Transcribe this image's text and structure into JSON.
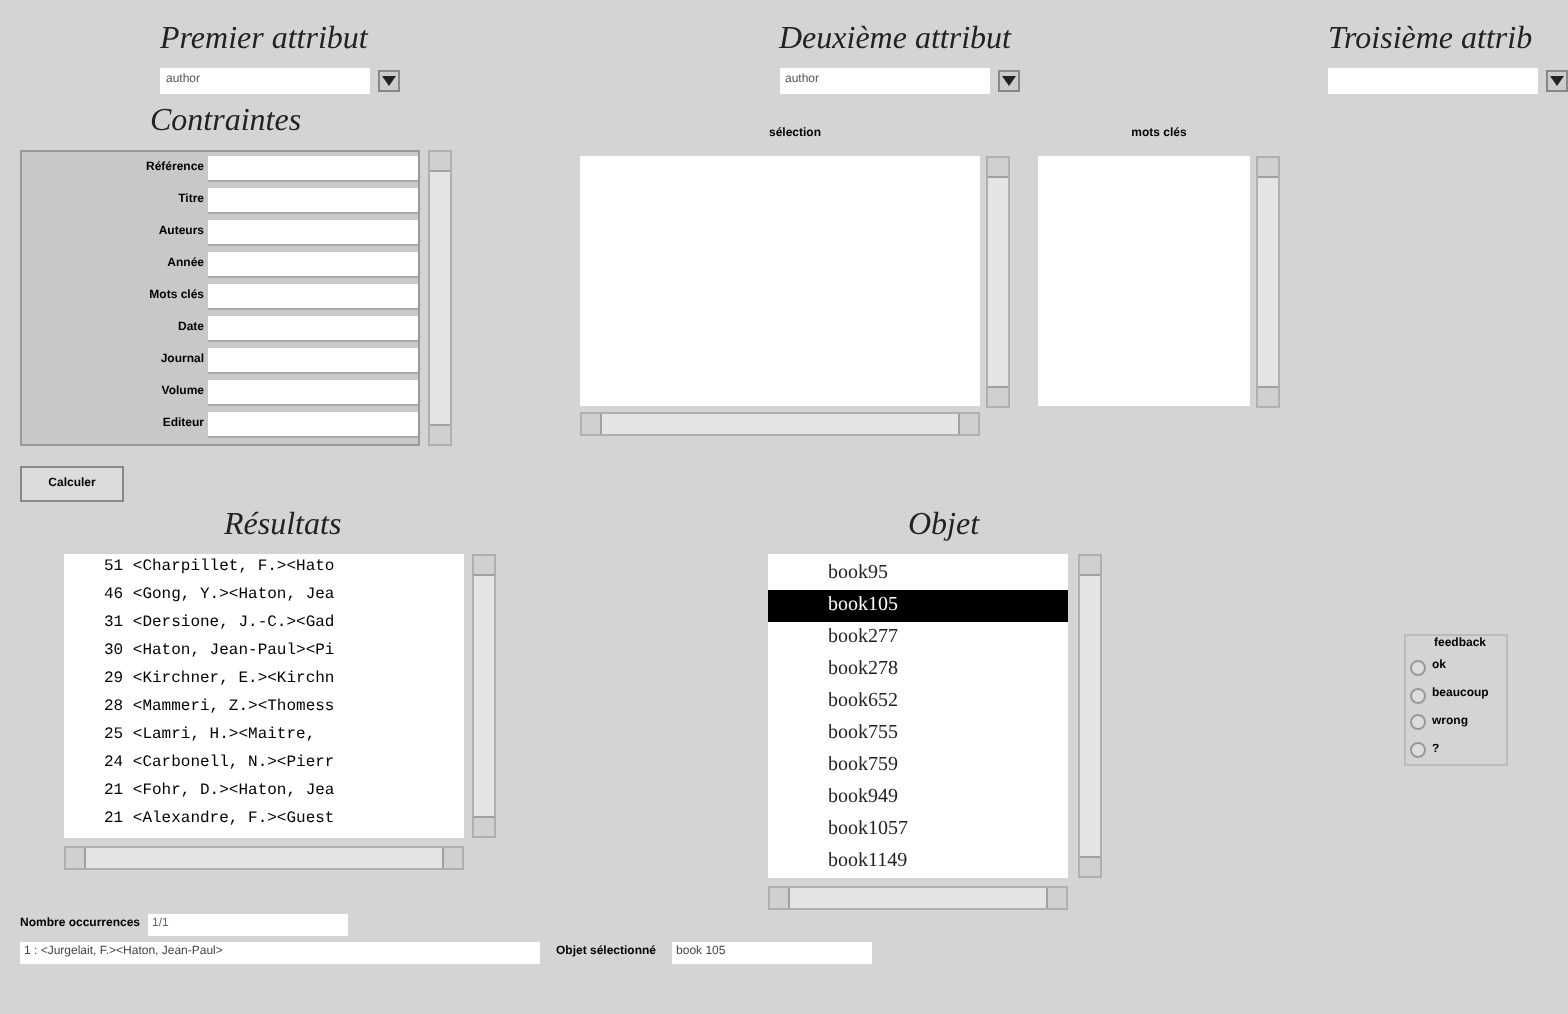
{
  "attributes": [
    {
      "title": "Premier attribut",
      "value": "author"
    },
    {
      "title": "Deuxième attribut",
      "value": "author"
    },
    {
      "title": "Troisième attrib"
    }
  ],
  "constraints": {
    "title": "Contraintes",
    "fields": [
      "Référence",
      "Titre",
      "Auteurs",
      "Année",
      "Mots clés",
      "Date",
      "Journal",
      "Volume",
      "Editeur"
    ]
  },
  "lists": [
    {
      "header": "sélection"
    },
    {
      "header": "mots clés"
    }
  ],
  "calculate_button": "Calculer",
  "results": {
    "title": "Résultats",
    "rows": [
      "51 <Charpillet, F.><Hato",
      "46 <Gong, Y.><Haton, Jea",
      "31 <Dersione, J.-C.><Gad",
      "30 <Haton, Jean-Paul><Pi",
      "29 <Kirchner, E.><Kirchn",
      "28 <Mammeri, Z.><Thomess",
      "25 <Lamri, H.><Maitre,",
      "24 <Carbonell, N.><Pierr",
      "21 <Fohr, D.><Haton, Jea",
      "21 <Alexandre, F.><Guest"
    ]
  },
  "object": {
    "title": "Objet",
    "items": [
      {
        "label": "book95",
        "selected": false
      },
      {
        "label": "book105",
        "selected": true
      },
      {
        "label": "book277",
        "selected": false
      },
      {
        "label": "book278",
        "selected": false
      },
      {
        "label": "book652",
        "selected": false
      },
      {
        "label": "book755",
        "selected": false
      },
      {
        "label": "book759",
        "selected": false
      },
      {
        "label": "book949",
        "selected": false
      },
      {
        "label": "book1057",
        "selected": false
      },
      {
        "label": "book1149",
        "selected": false
      }
    ]
  },
  "feedback": {
    "title": "feedback",
    "options": [
      {
        "label": "ok",
        "selected": false
      },
      {
        "label": "beaucoup",
        "selected": false
      },
      {
        "label": "wrong",
        "selected": false
      },
      {
        "label": "?",
        "selected": false
      }
    ]
  },
  "occurrences": {
    "label": "Nombre occurrences",
    "value": "1/1"
  },
  "status": {
    "text": "1 : <Jurgelait, F.><Haton, Jean-Paul>",
    "object_label": "Objet sélectionné",
    "object_value": "book 105"
  }
}
